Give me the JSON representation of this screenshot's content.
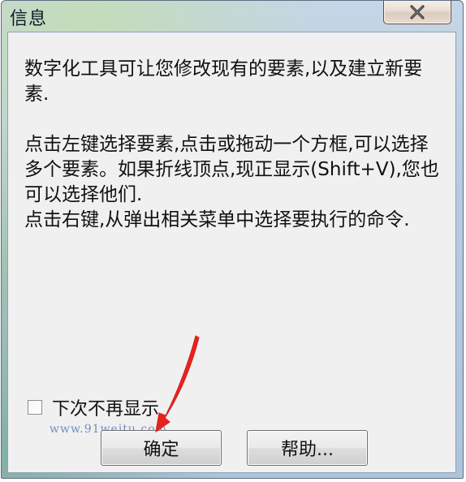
{
  "window": {
    "title": "信息",
    "close_glyph": "✕"
  },
  "message": {
    "lines": [
      "数字化工具可让您修改现有的要素,以及建立新要",
      "素.",
      "",
      "点击左键选择要素,点击或拖动一个方框,可以选择",
      "多个要素。如果折线顶点,现正显示(Shift+V),您也",
      "可以选择他们.",
      "点击右键,从弹出相关菜单中选择要执行的命令."
    ]
  },
  "checkbox": {
    "label": "下次不再显示",
    "checked": false
  },
  "watermark": "www.91weitu.com",
  "buttons": {
    "ok_label": "确定",
    "help_label": "帮助..."
  },
  "colors": {
    "arrow": "#e8231f",
    "client_bg": "#f0f0f0"
  }
}
